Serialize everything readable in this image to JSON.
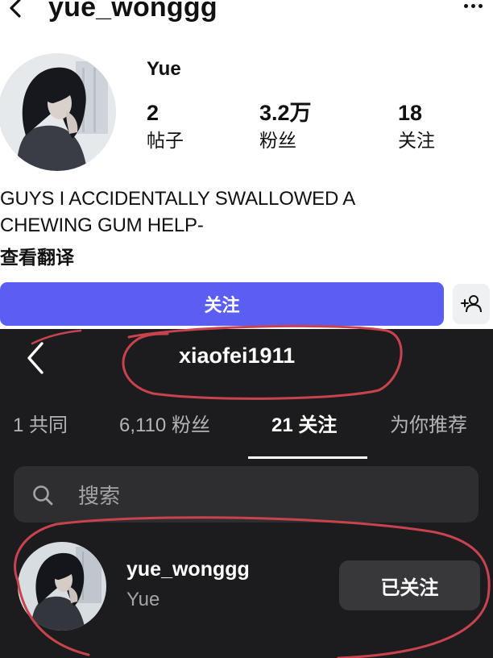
{
  "top_profile": {
    "username": "yue_wonggg",
    "display_name": "Yue",
    "stats": [
      {
        "value": "2",
        "label": "帖子"
      },
      {
        "value": "3.2万",
        "label": "粉丝"
      },
      {
        "value": "18",
        "label": "关注"
      }
    ],
    "bio_line1": "GUYS I ACCIDENTALLY SWALLOWED A",
    "bio_line2": "CHEWING GUM HELP-",
    "translate_label": "查看翻译",
    "follow_label": "关注",
    "icons": [
      "back-chevron-icon",
      "more-dots-icon",
      "add-user-icon"
    ],
    "accent_color": "#5b5ef3"
  },
  "bottom_list": {
    "username": "xiaofei1911",
    "tabs": [
      {
        "label": "1 共同",
        "active": false
      },
      {
        "label": "6,110 粉丝",
        "active": false
      },
      {
        "label": "21 关注",
        "active": true
      },
      {
        "label": "为你推荐",
        "active": false
      }
    ],
    "search_placeholder": "搜索",
    "user_item": {
      "handle": "yue_wonggg",
      "name": "Yue",
      "button_label": "已关注"
    },
    "icons": [
      "back-chevron-icon",
      "search-icon"
    ],
    "annotation_color": "#c8434e"
  }
}
